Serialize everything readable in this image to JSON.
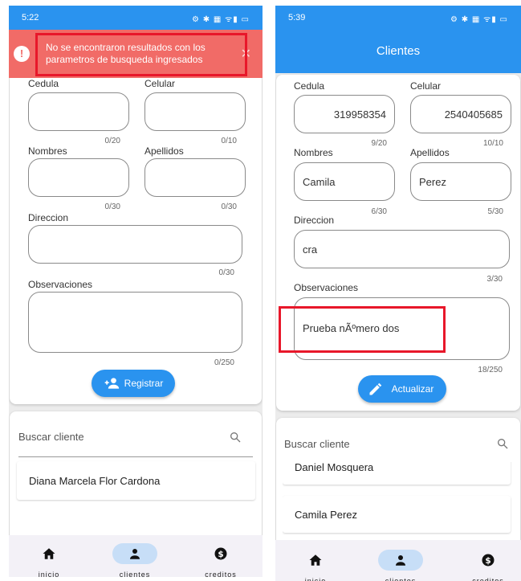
{
  "left": {
    "status": {
      "time": "5:22",
      "icons": "⚙ ✱ ▦ ᯤ▮ ▭"
    },
    "toast": {
      "message": "No se encontraron resultados con los parametros de busqueda ingresados",
      "close": "✕"
    },
    "form": {
      "cedula_label": "Cedula",
      "celular_label": "Celular",
      "cedula_count": "0/20",
      "celular_count": "0/10",
      "nombres_label": "Nombres",
      "apellidos_label": "Apellidos",
      "nombres_count": "0/30",
      "apellidos_count": "0/30",
      "direccion_label": "Direccion",
      "direccion_count": "0/30",
      "observaciones_label": "Observaciones",
      "observaciones_count": "0/250",
      "button_label": "Registrar"
    },
    "search": {
      "placeholder": "Buscar cliente"
    },
    "results": [
      "Diana Marcela Flor Cardona"
    ],
    "nav": {
      "inicio": "inicio",
      "clientes": "clientes",
      "creditos": "creditos"
    }
  },
  "right": {
    "status": {
      "time": "5:39",
      "icons": "⚙ ✱ ▦ ᯤ▮ ▭"
    },
    "appbar_title": "Clientes",
    "form": {
      "cedula_label": "Cedula",
      "celular_label": "Celular",
      "cedula_value": "319958354",
      "celular_value": "2540405685",
      "cedula_count": "9/20",
      "celular_count": "10/10",
      "nombres_label": "Nombres",
      "apellidos_label": "Apellidos",
      "nombres_value": "Camila",
      "apellidos_value": "Perez",
      "nombres_count": "6/30",
      "apellidos_count": "5/30",
      "direccion_label": "Direccion",
      "direccion_value": "cra",
      "direccion_count": "3/30",
      "observaciones_label": "Observaciones",
      "observaciones_value": "Prueba nÃºmero dos",
      "observaciones_count": "18/250",
      "button_label": "Actualizar"
    },
    "search": {
      "placeholder": "Buscar cliente"
    },
    "results": [
      "Daniel Mosquera",
      "Camila Perez"
    ],
    "nav": {
      "inicio": "inicio",
      "clientes": "clientes",
      "creditos": "creditos"
    }
  },
  "colors": {
    "primary": "#2a93ef",
    "toast": "#f16b67",
    "highlight": "#e8172a",
    "nav_active": "#c7def7"
  }
}
